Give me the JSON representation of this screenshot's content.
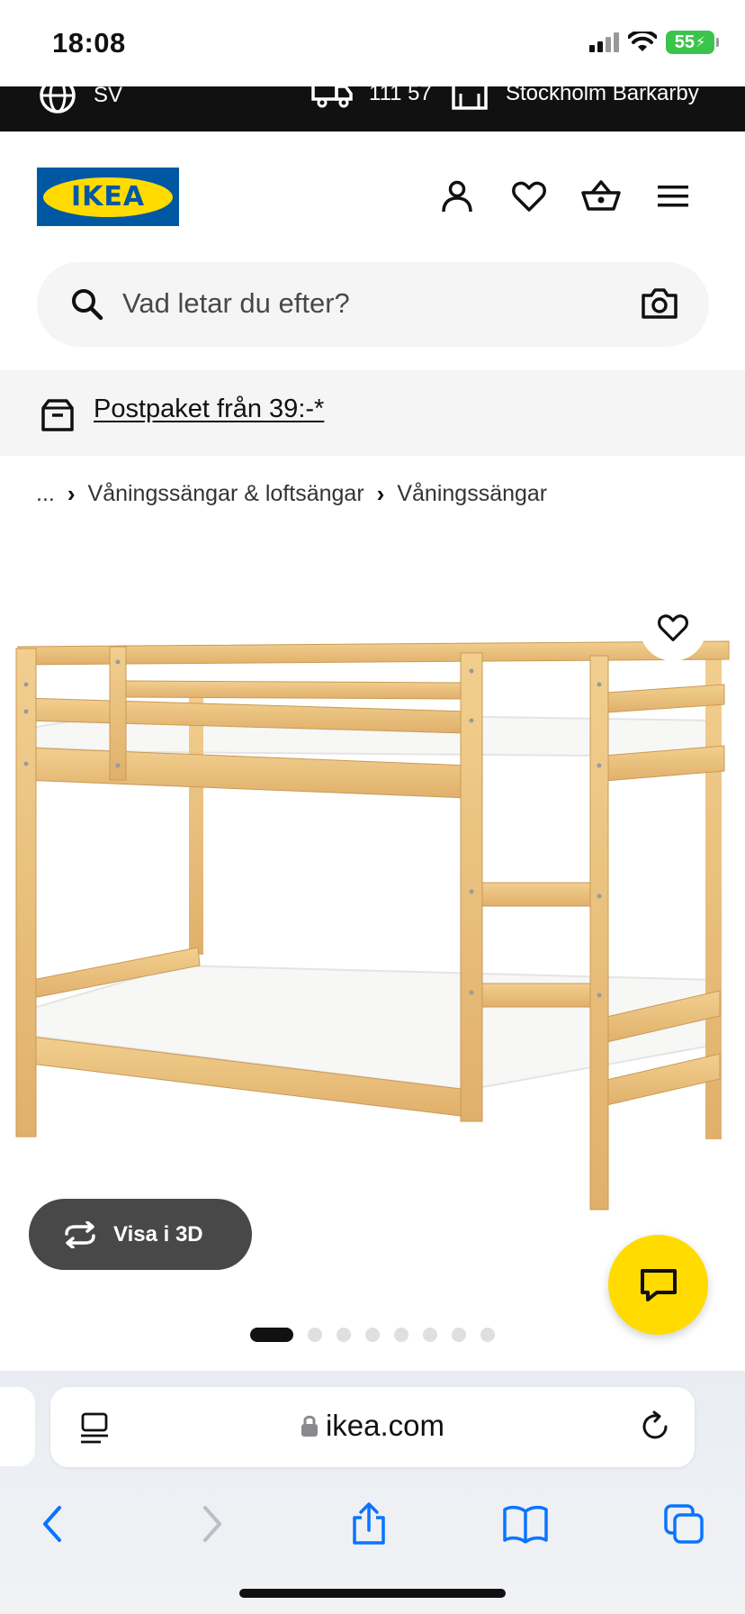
{
  "status_bar": {
    "time": "18:08",
    "battery": "55"
  },
  "top_strip": {
    "language": "SV",
    "delivery": "111 57",
    "store": "Stockholm Barkarby"
  },
  "header": {
    "logo_text": "IKEA"
  },
  "search": {
    "placeholder": "Vad letar du efter?"
  },
  "promo": {
    "text": "Postpaket från 39:-*"
  },
  "breadcrumb": {
    "ellipsis": "...",
    "items": [
      "Våningssängar & loftsängar",
      "Våningssängar"
    ]
  },
  "product": {
    "view3d_label": "Visa i 3D",
    "carousel": {
      "total": 8,
      "active": 1
    }
  },
  "browser": {
    "domain": "ikea.com"
  },
  "colors": {
    "ikea_blue": "#0058a3",
    "ikea_yellow": "#ffdb00",
    "pill_gray": "#484848",
    "link_blue": "#0a74ff"
  }
}
